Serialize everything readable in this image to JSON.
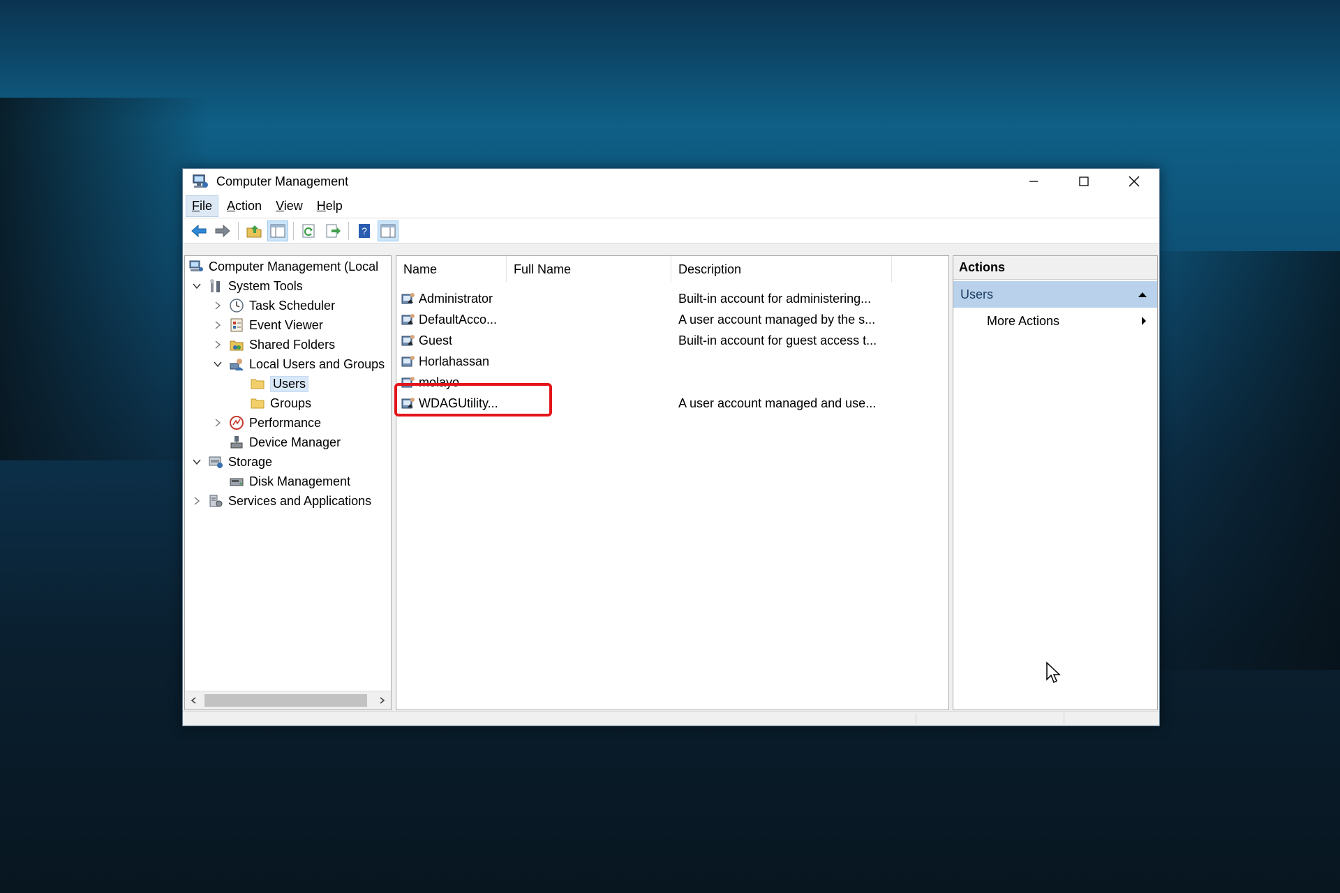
{
  "window": {
    "title": "Computer Management"
  },
  "menu": [
    "File",
    "Action",
    "View",
    "Help"
  ],
  "tree": {
    "root": "Computer Management (Local",
    "system_tools": "System Tools",
    "task_scheduler": "Task Scheduler",
    "event_viewer": "Event Viewer",
    "shared_folders": "Shared Folders",
    "local_users_groups": "Local Users and Groups",
    "users": "Users",
    "groups": "Groups",
    "performance": "Performance",
    "device_manager": "Device Manager",
    "storage": "Storage",
    "disk_management": "Disk Management",
    "services_apps": "Services and Applications"
  },
  "columns": {
    "name": "Name",
    "full_name": "Full Name",
    "description": "Description"
  },
  "users": [
    {
      "name": "Administrator",
      "full_name": "",
      "description": "Built-in account for administering..."
    },
    {
      "name": "DefaultAcco...",
      "full_name": "",
      "description": "A user account managed by the s..."
    },
    {
      "name": "Guest",
      "full_name": "",
      "description": "Built-in account for guest access t..."
    },
    {
      "name": "Horlahassan",
      "full_name": "",
      "description": ""
    },
    {
      "name": "molayo",
      "full_name": "",
      "description": ""
    },
    {
      "name": "WDAGUtility...",
      "full_name": "",
      "description": "A user account managed and use..."
    }
  ],
  "actions": {
    "header": "Actions",
    "section": "Users",
    "more": "More Actions"
  },
  "colors": {
    "highlight": "#e3151b",
    "selection": "#b9d1ea"
  }
}
